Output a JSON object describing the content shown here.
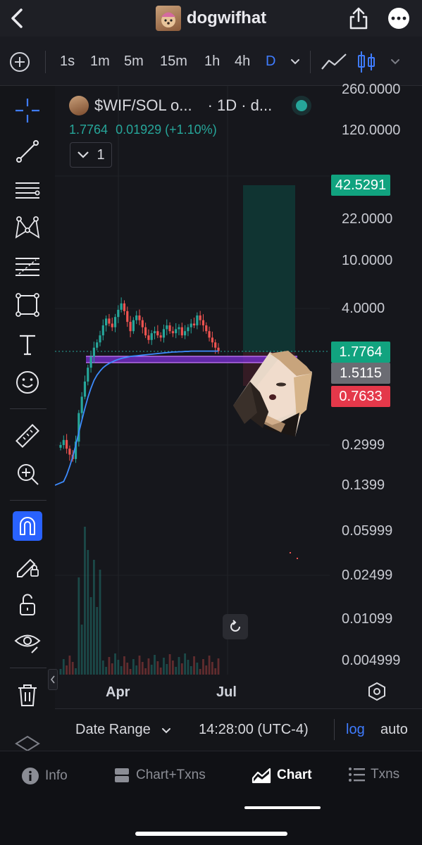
{
  "header": {
    "title": "dogwifhat",
    "back_icon": "chevron-left-icon",
    "share_icon": "share-icon",
    "more_icon": "more-horizontal-icon"
  },
  "timeframes": {
    "items": [
      "1s",
      "1m",
      "5m",
      "15m",
      "1h",
      "4h",
      "D"
    ],
    "active": "D"
  },
  "chart": {
    "symbol_label": "$WIF/SOL o...",
    "interval_label": "· 1D · d...",
    "price": "1.7764",
    "change": "0.01929 (+1.10%)",
    "collapse_count": "1",
    "colors": {
      "up": "#26a69a",
      "down": "#ef5350",
      "ma": "#3d8bfd",
      "zone": "#8b3fff",
      "background": "#16171c"
    }
  },
  "chart_data": {
    "type": "candlestick",
    "y_scale": "log",
    "y_ticks": [
      "260.0000",
      "120.0000",
      "22.0000",
      "10.0000",
      "4.0000",
      "0.2999",
      "0.1399",
      "0.05999",
      "0.02499",
      "0.01099",
      "0.004999"
    ],
    "x_ticks": [
      "Apr",
      "Jul"
    ],
    "price_tags": [
      {
        "label": "42.5291",
        "color": "#11a37f"
      },
      {
        "label": "1.7764",
        "color": "#11a37f"
      },
      {
        "label": "1.5115",
        "color": "#6b6c73"
      },
      {
        "label": "0.7633",
        "color": "#e4384a"
      }
    ],
    "close_series": [
      0.3,
      0.33,
      0.28,
      0.25,
      0.23,
      0.32,
      0.55,
      0.75,
      1.0,
      1.3,
      1.6,
      1.9,
      2.1,
      2.4,
      2.9,
      3.3,
      3.0,
      2.8,
      3.4,
      3.9,
      4.4,
      3.8,
      3.1,
      2.6,
      3.2,
      3.5,
      3.2,
      2.8,
      2.4,
      2.2,
      2.5,
      2.6,
      2.4,
      2.3,
      2.7,
      2.9,
      2.6,
      2.5,
      2.7,
      2.8,
      2.4,
      2.6,
      2.8,
      3.0,
      2.9,
      3.5,
      3.2,
      2.9,
      2.6,
      2.3,
      2.1,
      1.9,
      1.78
    ],
    "ma_series": [
      0.14,
      0.15,
      0.17,
      0.2,
      0.24,
      0.3,
      0.38,
      0.48,
      0.6,
      0.74,
      0.88,
      1.02,
      1.13,
      1.22,
      1.3,
      1.36,
      1.41,
      1.45,
      1.49,
      1.52,
      1.55,
      1.57,
      1.59,
      1.61,
      1.62,
      1.63,
      1.64,
      1.65,
      1.66,
      1.67,
      1.68,
      1.69,
      1.7,
      1.71,
      1.72,
      1.73,
      1.74,
      1.75,
      1.75,
      1.76,
      1.76,
      1.77,
      1.77,
      1.78,
      1.78,
      1.78,
      1.78,
      1.78,
      1.78,
      1.78,
      1.78,
      1.78,
      1.78
    ]
  },
  "bottom_controls": {
    "date_range": "Date Range",
    "time": "14:28:00 (UTC-4)",
    "log": "log",
    "auto": "auto"
  },
  "tabs": [
    {
      "label": "Info",
      "icon": "info-icon"
    },
    {
      "label": "Chart+Txns",
      "icon": "split-view-icon"
    },
    {
      "label": "Chart",
      "icon": "area-chart-icon"
    },
    {
      "label": "Txns",
      "icon": "list-icon"
    }
  ],
  "active_tab": "Chart"
}
